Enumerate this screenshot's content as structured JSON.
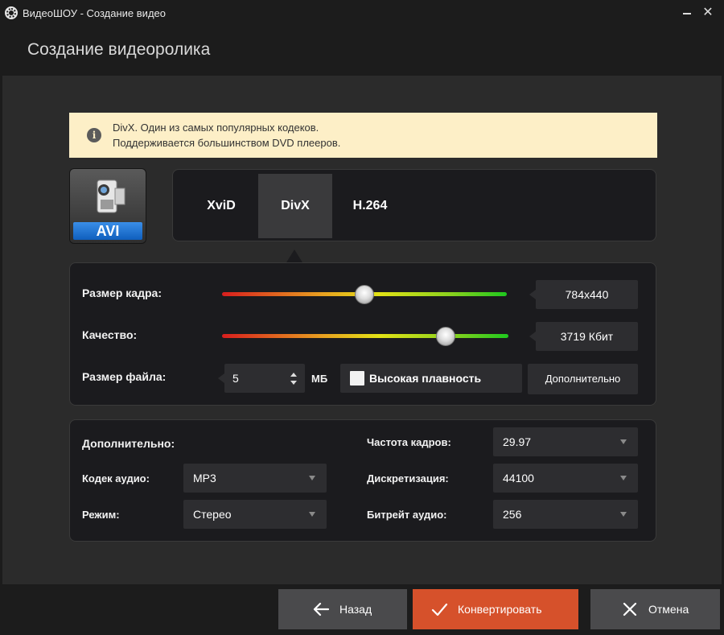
{
  "window": {
    "title": "ВидеоШОУ - Создание видео",
    "minimize_icon": "minimize-icon",
    "close_icon": "close-icon",
    "close_glyph": "✕"
  },
  "header": {
    "title": "Создание видеоролика"
  },
  "info": {
    "icon": "i",
    "line1": "DivX. Один из самых популярных кодеков.",
    "line2": "Поддерживается большинством DVD плееров."
  },
  "format": {
    "label": "AVI"
  },
  "codecs": {
    "tabs": [
      "XviD",
      "DivX",
      "H.264"
    ],
    "selected": "DivX"
  },
  "settings": {
    "frame_size": {
      "label": "Размер кадра:",
      "value": "784x440",
      "slider_fraction": 0.5
    },
    "quality": {
      "label": "Качество:",
      "value": "3719 Кбит",
      "slider_fraction": 0.78
    },
    "file_size": {
      "label": "Размер файла:",
      "value": "5",
      "unit": "МБ"
    },
    "smooth": {
      "label": "Высокая плавность",
      "checked": false
    },
    "advanced_button": "Дополнительно"
  },
  "advanced": {
    "title": "Дополнительно:",
    "audio_codec": {
      "label": "Кодек аудио:",
      "value": "MP3"
    },
    "mode": {
      "label": "Режим:",
      "value": "Стерео"
    },
    "frame_rate": {
      "label": "Частота кадров:",
      "value": "29.97"
    },
    "sampling": {
      "label": "Дискретизация:",
      "value": "44100"
    },
    "audio_bitrate": {
      "label": "Битрейт аудио:",
      "value": "256"
    }
  },
  "footer": {
    "back": "Назад",
    "convert": "Конвертировать",
    "cancel": "Отмена"
  },
  "colors": {
    "convert_button": "#d6512b",
    "info_background": "#fdefc7",
    "panel_background": "#1b1b1e"
  }
}
